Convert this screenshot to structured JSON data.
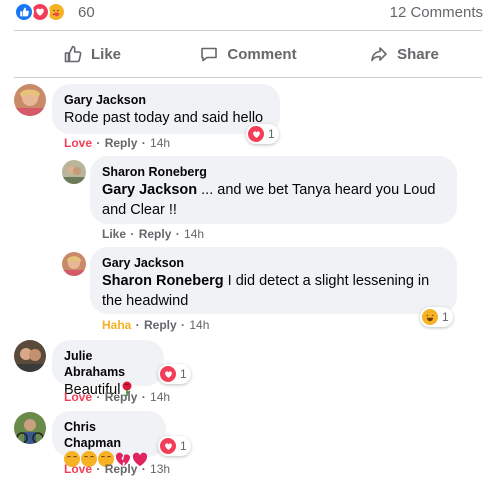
{
  "summary": {
    "reaction_count": "60",
    "comments_label": "12 Comments"
  },
  "actions": {
    "like": "Like",
    "comment": "Comment",
    "share": "Share"
  },
  "comments": [
    {
      "author": "Gary Jackson",
      "text": "Rode past today and said hello",
      "reaction": "Love",
      "reply": "Reply",
      "time": "14h",
      "react_count": "1"
    },
    {
      "author": "Sharon Roneberg",
      "mention": "Gary Jackson",
      "text": " ... and we bet Tanya heard you Loud and Clear !!",
      "reaction": "Like",
      "reply": "Reply",
      "time": "14h"
    },
    {
      "author": "Gary Jackson",
      "mention": "Sharon Roneberg",
      "text": " I did detect a slight lessening in the headwind",
      "reaction": "Haha",
      "reply": "Reply",
      "time": "14h",
      "react_count": "1"
    },
    {
      "author": "Julie Abrahams",
      "text": "Beautiful",
      "reaction": "Love",
      "reply": "Reply",
      "time": "14h",
      "react_count": "1"
    },
    {
      "author": "Chris Chapman",
      "text": "",
      "reaction": "Love",
      "reply": "Reply",
      "time": "13h",
      "react_count": "1"
    }
  ],
  "colors": {
    "like_blue": "#1877f2",
    "love_red": "#f33e58",
    "haha_yellow": "#f7b125",
    "meta_gray": "#65676b",
    "bubble_bg": "#f0f2f5"
  }
}
